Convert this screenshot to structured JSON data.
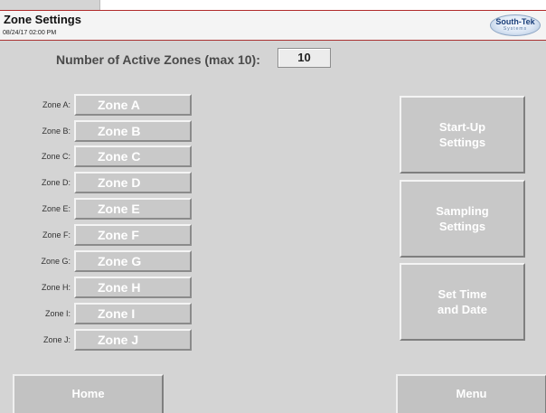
{
  "header": {
    "title": "Zone Settings",
    "timestamp": "08/24/17  02:00 PM",
    "logo_main": "South-Tek",
    "logo_sub": "Systems"
  },
  "active_zones": {
    "label": "Number of Active Zones (max 10):",
    "value": "10"
  },
  "zones": [
    {
      "label": "Zone A:",
      "value": "Zone A"
    },
    {
      "label": "Zone B:",
      "value": "Zone B"
    },
    {
      "label": "Zone C:",
      "value": "Zone C"
    },
    {
      "label": "Zone D:",
      "value": "Zone D"
    },
    {
      "label": "Zone E:",
      "value": "Zone E"
    },
    {
      "label": "Zone F:",
      "value": "Zone F"
    },
    {
      "label": "Zone G:",
      "value": "Zone G"
    },
    {
      "label": "Zone H:",
      "value": "Zone H"
    },
    {
      "label": "Zone I:",
      "value": "Zone I"
    },
    {
      "label": "Zone J:",
      "value": "Zone J"
    }
  ],
  "side_buttons": {
    "startup": "Start-Up\nSettings",
    "sampling": "Sampling\nSettings",
    "time": "Set Time\nand Date"
  },
  "nav": {
    "home": "Home",
    "menu": "Menu"
  },
  "colors": {
    "panel": "#d4d4d4",
    "header_border": "#b02a2a",
    "button": "#c8c8c8"
  }
}
